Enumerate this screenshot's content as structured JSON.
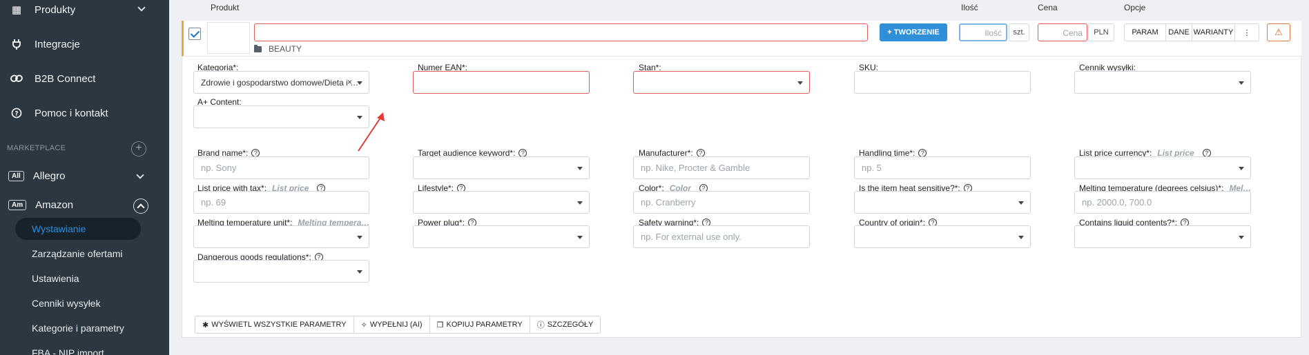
{
  "sidebar": {
    "items": [
      {
        "label": "Produkty",
        "icon": "boxes-icon"
      },
      {
        "label": "Integracje",
        "icon": "plug-icon"
      },
      {
        "label": "B2B Connect",
        "icon": "link-icon"
      },
      {
        "label": "Pomoc i kontakt",
        "icon": "help-icon"
      }
    ],
    "section_label": "MARKETPLACE",
    "marketplaces": [
      {
        "badge": "All",
        "label": "Allegro"
      },
      {
        "badge": "Am",
        "label": "Amazon"
      }
    ],
    "amazon_sub": [
      {
        "label": "Wystawianie",
        "active": true
      },
      {
        "label": "Zarządzanie ofertami"
      },
      {
        "label": "Ustawienia"
      },
      {
        "label": "Cenniki wysyłek"
      },
      {
        "label": "Kategorie i parametry"
      },
      {
        "label": "FBA - NIP import"
      }
    ]
  },
  "columns": {
    "product": "Produkt",
    "qty": "Ilość",
    "price": "Cena",
    "options": "Opcje"
  },
  "product_row": {
    "folder": "BEAUTY",
    "create_label": "+ TWORZENIE",
    "qty_placeholder": "Ilość",
    "unit": "szt.",
    "price_placeholder": "Cena",
    "currency": "PLN",
    "options": [
      "PARAM",
      "DANE",
      "WARIANTY",
      "⋮"
    ],
    "warn_icon": "warning-icon"
  },
  "fields": {
    "category_label": "Kategoria*:",
    "category_value": "Zdrowie i gospodarstwo domowe/Dieta i ży...",
    "ean_label": "Numer EAN*:",
    "stan_label": "Stan*:",
    "sku_label": "SKU:",
    "shipping_label": "Cennik wysyłki:",
    "aplus_label": "A+ Content:",
    "brand_label": "Brand name*:",
    "brand_ph": "np. Sony",
    "target_label": "Target audience keyword*:",
    "manufacturer_label": "Manufacturer*:",
    "manufacturer_ph": "np. Nike, Procter & Gamble",
    "handling_label": "Handling time*:",
    "handling_ph": "np. 5",
    "list_currency_label": "List price currency*:",
    "list_currency_hint": "List price",
    "list_price_label": "List price with tax*:",
    "list_price_hint": "List price",
    "list_price_ph": "np. 69",
    "lifestyle_label": "Lifestyle*:",
    "color_label": "Color*:",
    "color_hint": "Color",
    "color_ph": "np. Cranberry",
    "heat_label": "Is the item heat sensitive?*:",
    "melt_temp_label": "Melting temperature (degrees celsius)*:",
    "melt_temp_hint": "Melting t...",
    "melt_temp_ph": "np. 2000.0, 700.0",
    "melt_unit_label": "Melting temperature unit*:",
    "melt_unit_hint": "Melting temperature (...",
    "power_label": "Power plug*:",
    "safety_label": "Safety warning*:",
    "safety_ph": "np. For external use only.",
    "country_label": "Country of origin*:",
    "liquid_label": "Contains liquid contents?*:",
    "dangerous_label": "Dangerous goods regulations*:"
  },
  "bottom_actions": [
    {
      "icon": "✱",
      "label": "WYŚWIETL WSZYSTKIE PARAMETRY"
    },
    {
      "icon": "✧",
      "label": "WYPEŁNIJ (AI)"
    },
    {
      "icon": "❐",
      "label": "KOPIUJ PARAMETRY"
    },
    {
      "icon": "ⓘ",
      "label": "SZCZEGÓŁY"
    }
  ],
  "colors": {
    "sidebar": "#2c3740",
    "accent": "#2f8fd8",
    "error": "#e05a5a",
    "annotation": "#e53935"
  }
}
